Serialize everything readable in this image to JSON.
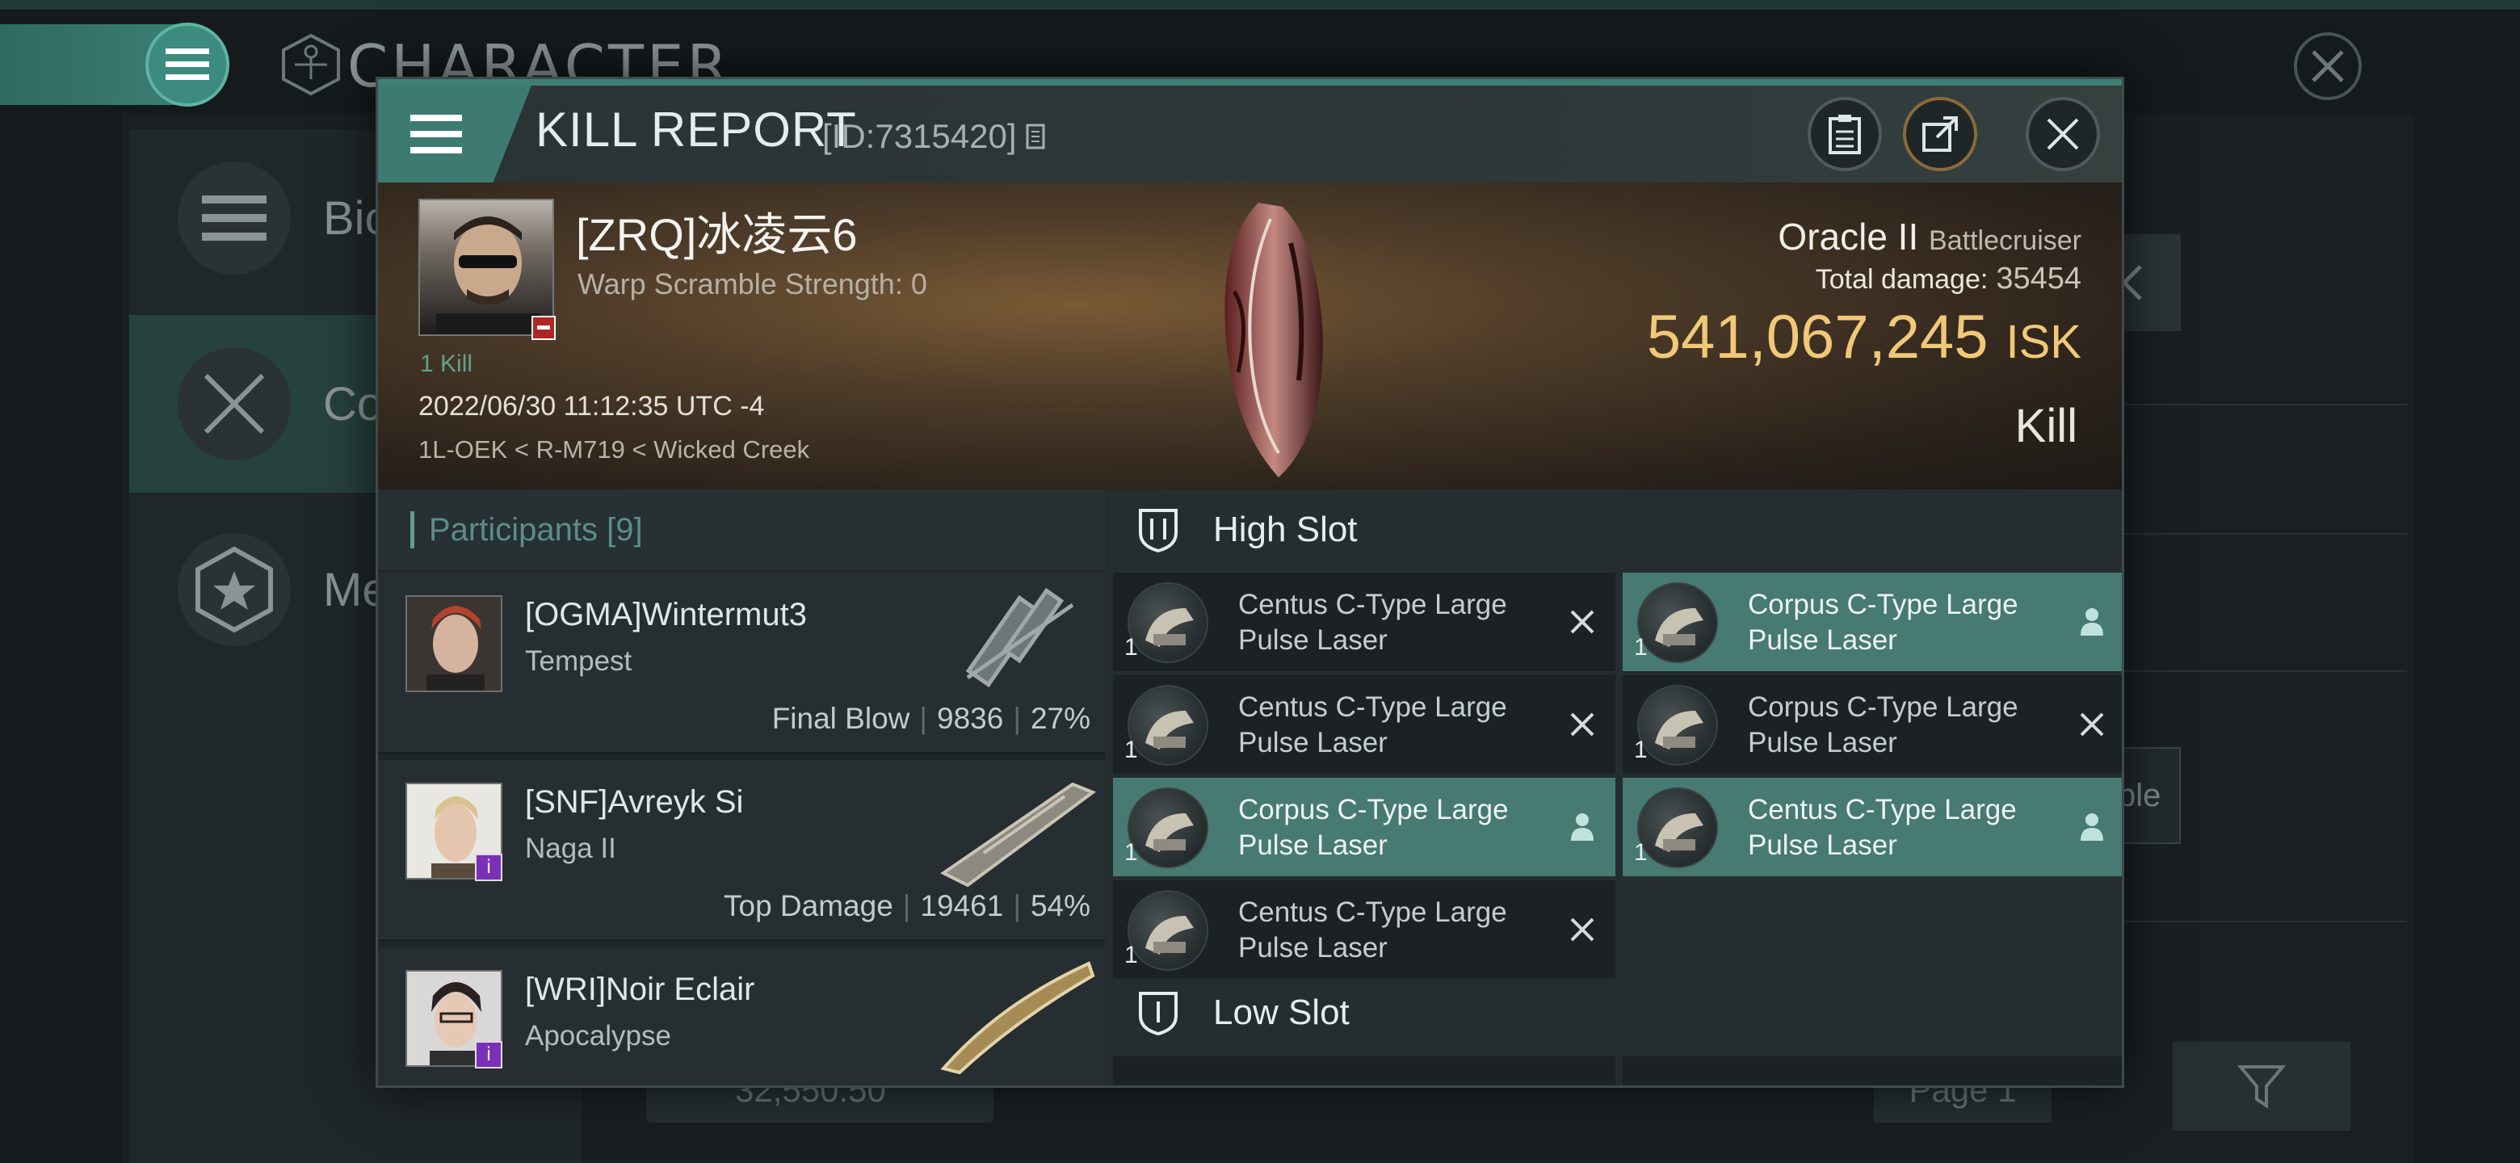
{
  "background": {
    "title": "CHARACTER",
    "sidebar": [
      {
        "label": "Bio",
        "icon": "bio-icon"
      },
      {
        "label": "Com",
        "icon": "combat-icon"
      },
      {
        "label": "Med",
        "icon": "medal-icon"
      }
    ],
    "right_box_text": "ble",
    "bottom_input": "32,550.50",
    "page_label": "Page 1"
  },
  "dialog": {
    "title": "KILL REPORT",
    "id_text": "[ID:7315420]",
    "victim": {
      "name": "[ZRQ]冰凌云6",
      "warp_scramble": "Warp Scramble Strength: 0",
      "kill_count": "1 Kill",
      "datetime": "2022/06/30 11:12:35 UTC -4",
      "location": "1L-OEK < R-M719 < Wicked Creek"
    },
    "ship": {
      "name": "Oracle II",
      "class": "Battlecruiser",
      "damage_label": "Total damage:",
      "damage_value": "35454",
      "isk_value": "541,067,245",
      "isk_unit": "ISK",
      "result": "Kill"
    },
    "participants": {
      "header": "Participants [9]",
      "rows": [
        {
          "name": "[OGMA]Wintermut3",
          "ship": "Tempest",
          "role": "Final Blow",
          "damage": "9836",
          "percent": "27%"
        },
        {
          "name": "[SNF]Avreyk Si",
          "ship": "Naga II",
          "role": "Top Damage",
          "damage": "19461",
          "percent": "54%"
        },
        {
          "name": "[WRI]Noir Eclair",
          "ship": "Apocalypse",
          "role": "",
          "damage": "",
          "percent": ""
        }
      ]
    },
    "high_slot": {
      "header": "High Slot",
      "items": [
        {
          "line1": "Centus C-Type Large",
          "line2": "Pulse Laser",
          "qty": "1",
          "state": "destroyed"
        },
        {
          "line1": "Corpus C-Type Large",
          "line2": "Pulse Laser",
          "qty": "1",
          "state": "dropped"
        },
        {
          "line1": "Centus C-Type Large",
          "line2": "Pulse Laser",
          "qty": "1",
          "state": "destroyed"
        },
        {
          "line1": "Corpus C-Type Large",
          "line2": "Pulse Laser",
          "qty": "1",
          "state": "destroyed"
        },
        {
          "line1": "Corpus C-Type Large",
          "line2": "Pulse Laser",
          "qty": "1",
          "state": "dropped"
        },
        {
          "line1": "Centus C-Type Large",
          "line2": "Pulse Laser",
          "qty": "1",
          "state": "dropped"
        },
        {
          "line1": "Centus C-Type Large",
          "line2": "Pulse Laser",
          "qty": "1",
          "state": "destroyed"
        }
      ]
    },
    "low_slot": {
      "header": "Low Slot"
    }
  },
  "colors": {
    "accent": "#3d7a71",
    "isk": "#f0c878",
    "dropped": "#467a72"
  }
}
